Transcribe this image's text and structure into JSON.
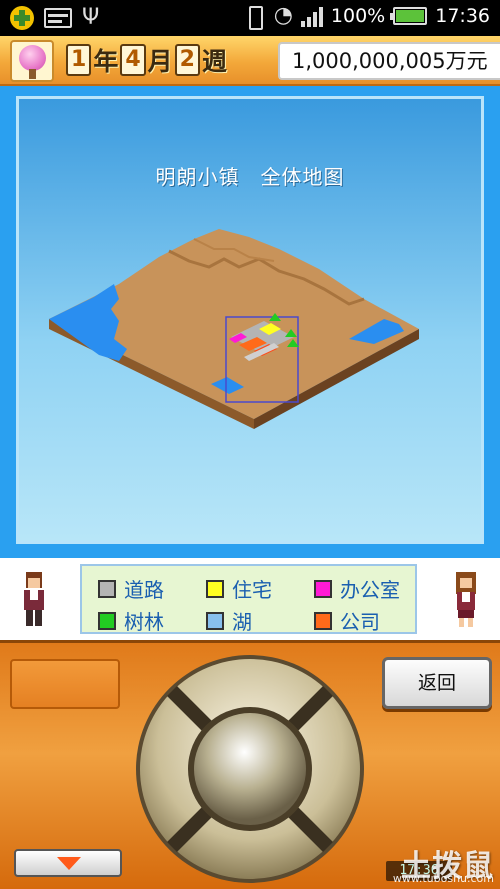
{
  "status_bar": {
    "battery_percent": "100%",
    "time": "17:36",
    "icons": [
      "app-plus-icon",
      "card-icon",
      "usb-icon",
      "vibrate-icon",
      "wifi-icon",
      "signal-icon",
      "battery-icon"
    ]
  },
  "top_bar": {
    "year_num": "1",
    "year_unit": "年",
    "month_num": "4",
    "month_unit": "月",
    "week_num": "2",
    "week_unit": "週",
    "money": "1,000,000,005万元"
  },
  "map": {
    "title": "明朗小镇　全体地图"
  },
  "legend": {
    "items": [
      {
        "label": "道路",
        "color": "#b4b4b4"
      },
      {
        "label": "住宅",
        "color": "#ffff22"
      },
      {
        "label": "办公室",
        "color": "#ff1ad6"
      },
      {
        "label": "树林",
        "color": "#22cc22"
      },
      {
        "label": "湖",
        "color": "#88c0ee"
      },
      {
        "label": "公司",
        "color": "#ff6a1a"
      }
    ]
  },
  "controls": {
    "back_label": "返回",
    "clock_text": "17:36"
  },
  "watermark": {
    "main": "土拨鼠",
    "sub": "www.tuboshu.com"
  },
  "colors": {
    "sky": "#2aa0f0",
    "land": "#c8935a",
    "water": "#2a8ef0",
    "panel_orange": "#f0a040"
  }
}
